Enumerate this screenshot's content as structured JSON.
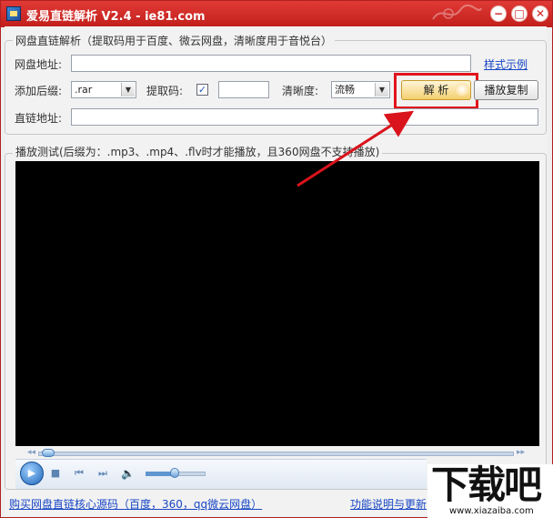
{
  "window": {
    "title": "爱易直链解析 V2.4 - ie81.com",
    "accent_color": "#d62a25",
    "buttons": [
      "minimize-button",
      "maximize-button",
      "close-button"
    ],
    "minimize_label": "−",
    "maximize_label": "□",
    "close_label": "✕"
  },
  "parse_group": {
    "label": "网盘直链解析（提取码用于百度、微云网盘，清晰度用于音悦台）",
    "disk_url_label": "网盘地址:",
    "disk_url_value": "",
    "style_example_link": "样式示例",
    "suffix_label": "添加后缀:",
    "suffix_value": ".rar",
    "extract_code_label": "提取码:",
    "extract_code_checked": true,
    "extract_code_value": "",
    "clarity_label": "清晰度:",
    "clarity_value": "流畅",
    "parse_button": "解 析",
    "play_copy_button": "播放复制",
    "direct_url_label": "直链地址:",
    "direct_url_value": ""
  },
  "play_group": {
    "label": "播放测试(后缀为：.mp3、.mp4、.flv时才能播放，且360网盘不支持播放)"
  },
  "player": {
    "seek_position": 0.01,
    "volume_level": 0.5,
    "icons": [
      "play-icon",
      "stop-icon",
      "previous-icon",
      "next-icon",
      "volume-icon"
    ]
  },
  "footer": {
    "buy_link": "购买网盘直链核心源码（百度，360，qq微云网盘）",
    "help_link": "功能说明与更新"
  },
  "watermark": {
    "brand": "下载吧",
    "url": "www.xiazaiba.com"
  },
  "annotation": {
    "highlight_color": "#e0141c"
  }
}
